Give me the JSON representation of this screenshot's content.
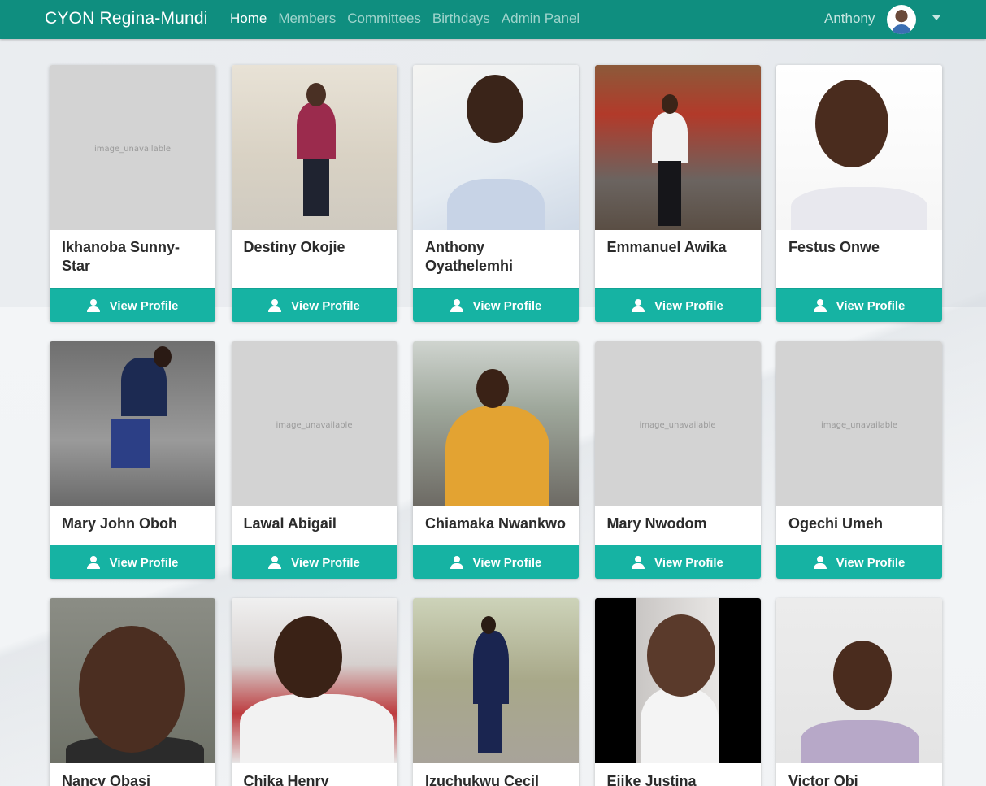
{
  "nav": {
    "brand": "CYON Regina-Mundi",
    "links": [
      "Home",
      "Members",
      "Committees",
      "Birthdays",
      "Admin Panel"
    ],
    "active": "Home",
    "user": "Anthony"
  },
  "placeholder_text": "image_unavailable",
  "button_label": "View Profile",
  "colors": {
    "navbar": "#0f8e7f",
    "button": "#16b3a3",
    "placeholder": "#d3d3d3"
  },
  "members": [
    {
      "name": "Ikhanoba Sunny-Star",
      "has_photo": false
    },
    {
      "name": "Destiny Okojie",
      "has_photo": true
    },
    {
      "name": "Anthony Oyathelemhi",
      "has_photo": true
    },
    {
      "name": "Emmanuel Awika",
      "has_photo": true
    },
    {
      "name": "Festus Onwe",
      "has_photo": true
    },
    {
      "name": "Mary John Oboh",
      "has_photo": true
    },
    {
      "name": "Lawal Abigail",
      "has_photo": false
    },
    {
      "name": "Chiamaka Nwankwo",
      "has_photo": true
    },
    {
      "name": "Mary Nwodom",
      "has_photo": false
    },
    {
      "name": "Ogechi Umeh",
      "has_photo": false
    },
    {
      "name": "Nancy Obasi",
      "has_photo": true
    },
    {
      "name": "Chika Henry",
      "has_photo": true
    },
    {
      "name": "Izuchukwu Cecil",
      "has_photo": true
    },
    {
      "name": "Ejike Justina",
      "has_photo": true
    },
    {
      "name": "Victor Obi",
      "has_photo": true
    }
  ]
}
